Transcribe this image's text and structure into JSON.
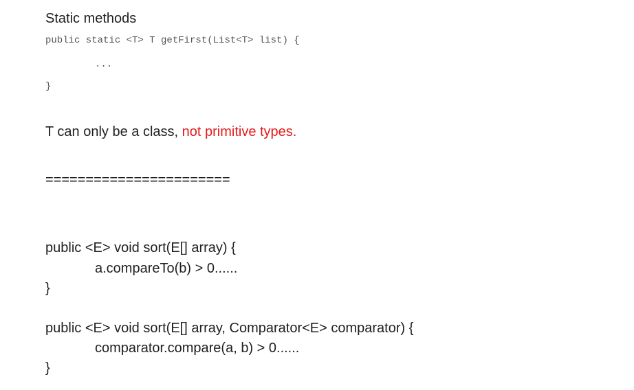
{
  "heading": "Static methods",
  "code_block": {
    "signature": "public static <T> T getFirst(List<T> list) {",
    "body": "...",
    "close": "}"
  },
  "note": {
    "prefix": "T can only be a class, ",
    "highlight": "not primitive types."
  },
  "separator": "=======================",
  "sort_simple": {
    "signature": "public <E> void sort(E[] array) {",
    "body": "a.compareTo(b) > 0......",
    "close": "}"
  },
  "sort_comparator": {
    "signature": "public <E> void sort(E[] array, Comparator<E> comparator) {",
    "body": "comparator.compare(a, b) > 0......",
    "close": "}"
  },
  "colors": {
    "text": "#1f1f1f",
    "code_text": "#555555",
    "highlight": "#e51b1b"
  }
}
